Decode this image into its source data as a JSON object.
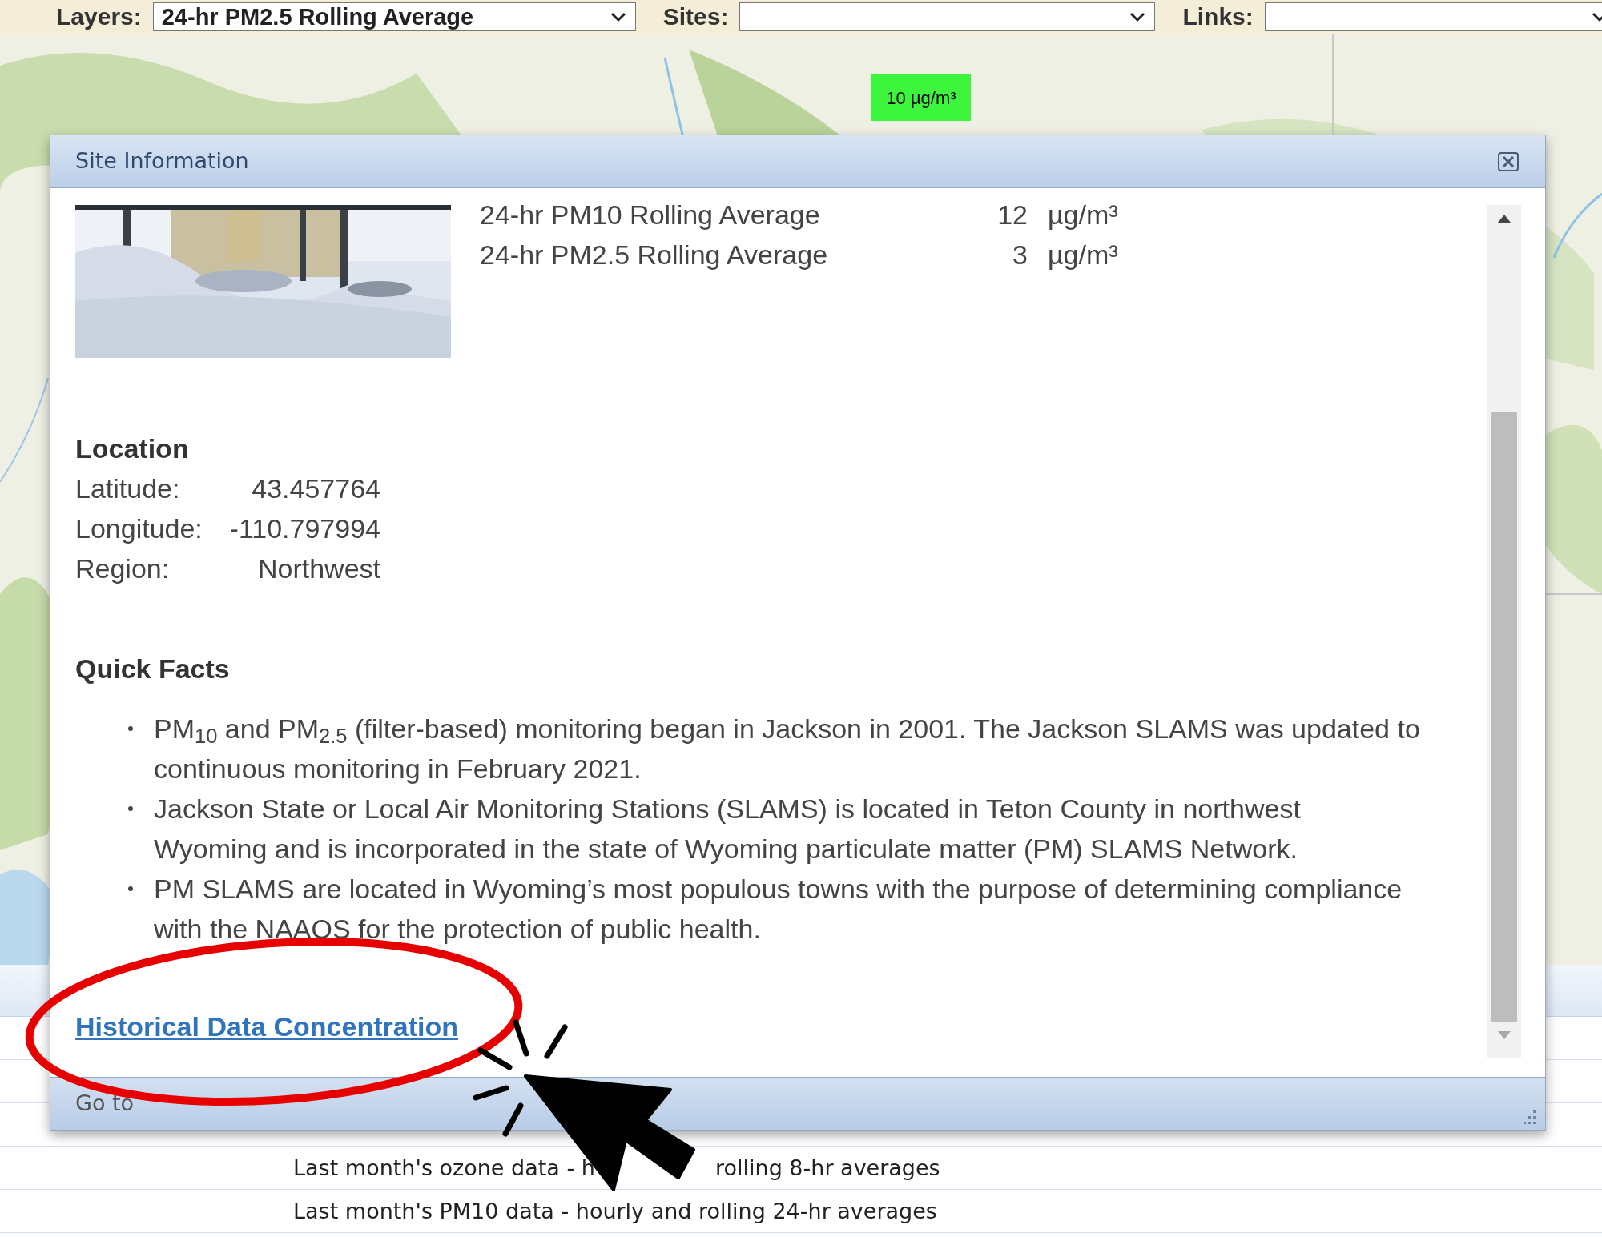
{
  "toolbar": {
    "fields": [
      {
        "label": "Layers:",
        "value": "24-hr PM2.5 Rolling Average"
      },
      {
        "label": "Sites:"
      },
      {
        "label": "Links:"
      }
    ]
  },
  "map": {
    "kind": "picture",
    "marker": "10 µg/m³"
  },
  "table": {
    "rows": [
      {
        "parts": [
          "Last month's ozone data - h",
          "rolling 8-hr averages"
        ]
      },
      {
        "parts": [
          "Last month's PM10 data - hourly and rolling 24-hr averages"
        ]
      }
    ]
  },
  "dialog": {
    "title": "Site Information",
    "measurements": [
      {
        "name": "24-hr PM10 Rolling Average",
        "value": "12",
        "unit": "µg/m³"
      },
      {
        "name": "24-hr PM2.5 Rolling Average",
        "value": "3",
        "unit": "µg/m³"
      }
    ],
    "location": {
      "heading": "Location",
      "rows": [
        {
          "label": "Latitude:",
          "value": "43.457764"
        },
        {
          "label": "Longitude:",
          "value": "-110.797994"
        },
        {
          "label": "Region:",
          "value": "Northwest"
        }
      ]
    },
    "quick_facts": {
      "heading": "Quick Facts",
      "items": [
        "PM$_{10}$ and PM$_{2.5}$ (filter-based) monitoring began in Jackson in 2001. The Jackson SLAMS was updated to continuous monitoring in February 2021.",
        "Jackson State or Local Air Monitoring Stations (SLAMS) is located in Teton County in northwest Wyoming and is incorporated in the state of Wyoming particulate matter (PM) SLAMS Network.",
        "PM SLAMS are located in Wyoming’s most populous towns with the purpose of determining compliance with the NAAQS for the protection of public health."
      ]
    },
    "link": "Historical Data Concentration",
    "footer_link": "Go to"
  }
}
